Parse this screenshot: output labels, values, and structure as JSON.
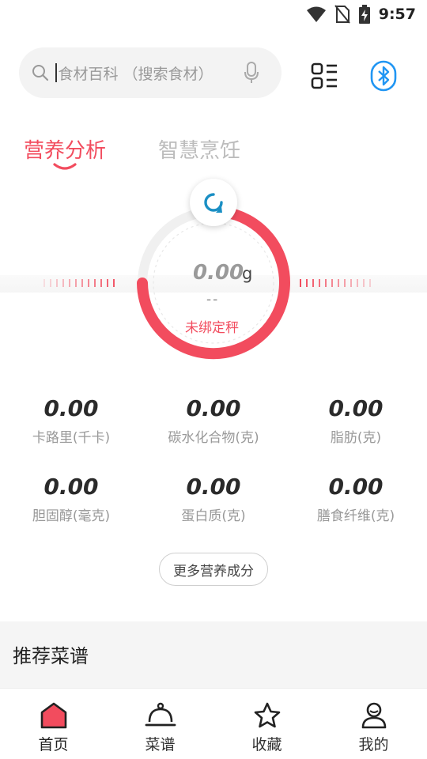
{
  "status_bar": {
    "time": "9:57",
    "icons": [
      "wifi-icon",
      "no-sim-icon",
      "battery-charging-icon"
    ]
  },
  "header": {
    "search_placeholder": "食材百科 （搜索食材）",
    "icons": [
      "search-icon",
      "microphone-icon",
      "scan-icon",
      "bluetooth-icon"
    ]
  },
  "tabs": [
    {
      "label": "营养分析",
      "active": true
    },
    {
      "label": "智慧烹饪",
      "active": false
    }
  ],
  "scale": {
    "weight": "0.00",
    "unit": "g",
    "sub_value": "--",
    "status": "未绑定秤"
  },
  "nutrition": [
    {
      "value": "0.00",
      "label": "卡路里(千卡)"
    },
    {
      "value": "0.00",
      "label": "碳水化合物(克)"
    },
    {
      "value": "0.00",
      "label": "脂肪(克)"
    },
    {
      "value": "0.00",
      "label": "胆固醇(毫克)"
    },
    {
      "value": "0.00",
      "label": "蛋白质(克)"
    },
    {
      "value": "0.00",
      "label": "膳食纤维(克)"
    }
  ],
  "more_button": "更多营养成分",
  "recommend": {
    "title": "推荐菜谱"
  },
  "bottom_nav": [
    {
      "label": "首页",
      "icon": "home-icon",
      "active": true
    },
    {
      "label": "菜谱",
      "icon": "cloche-icon",
      "active": false
    },
    {
      "label": "收藏",
      "icon": "star-icon",
      "active": false
    },
    {
      "label": "我的",
      "icon": "user-icon",
      "active": false
    }
  ],
  "colors": {
    "accent": "#f24c5e",
    "bluetooth": "#2196f3",
    "refresh": "#1a8fc4"
  }
}
